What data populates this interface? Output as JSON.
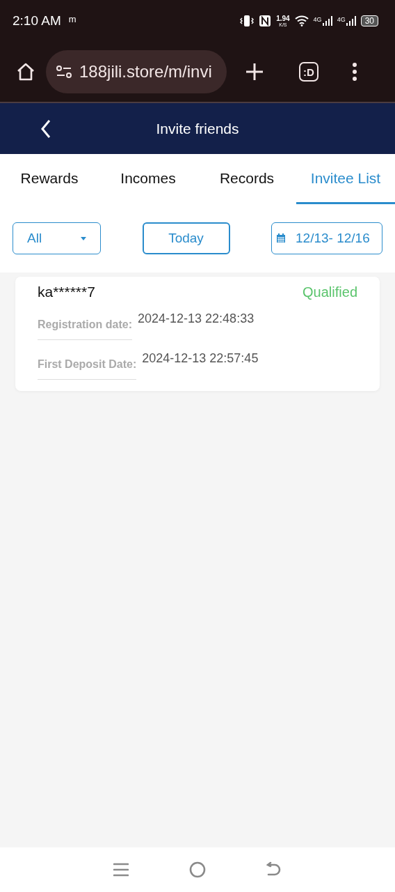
{
  "status_bar": {
    "time": "2:10 AM",
    "notification": "m",
    "speed": "1.94",
    "speed_unit": "K/S",
    "network_1": "4G",
    "network_2": "4G",
    "battery": "30"
  },
  "browser": {
    "url": "188jili.store/m/invi",
    "tab_label": ":D"
  },
  "header": {
    "title": "Invite friends"
  },
  "tabs": [
    {
      "label": "Rewards",
      "selected": false
    },
    {
      "label": "Incomes",
      "selected": false
    },
    {
      "label": "Records",
      "selected": false
    },
    {
      "label": "Invitee List",
      "selected": true
    }
  ],
  "filters": {
    "status": "All",
    "today": "Today",
    "date_range": "12/13- 12/16"
  },
  "invitees": [
    {
      "name": "ka******7",
      "status": "Qualified",
      "fields": [
        {
          "label": "Registration date:",
          "value": "2024-12-13 22:48:33"
        },
        {
          "label": "First Deposit Date:",
          "value": "2024-12-13 22:57:45"
        }
      ]
    }
  ]
}
